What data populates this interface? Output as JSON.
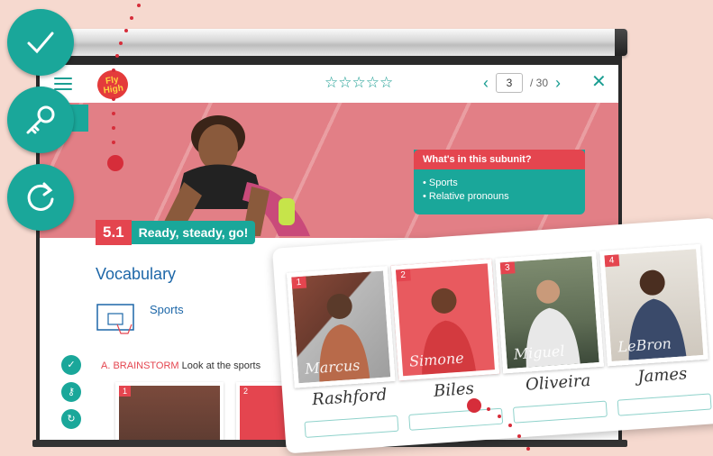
{
  "header": {
    "logo_text": "Fly High",
    "rating_stars": "☆☆☆☆☆",
    "prev_icon": "chevron-left-icon",
    "next_icon": "chevron-right-icon",
    "page_current": "3",
    "page_total": "/ 30",
    "close_icon": "close-icon"
  },
  "hero": {
    "subunit_title": "What's in this subunit?",
    "subunit_items": [
      "Sports",
      "Relative pronouns"
    ],
    "unit_number": "5.1",
    "unit_title": "Ready, steady, go!"
  },
  "content": {
    "section_title": "Vocabulary",
    "topic_label": "Sports",
    "exercise_prefix": "A. BRAINSTORM",
    "exercise_text": "Look at the sports"
  },
  "tools": [
    "check-icon",
    "key-icon",
    "refresh-icon"
  ],
  "cards": [
    {
      "n": "1",
      "signature": "Marcus",
      "handwritten": "Rashford"
    },
    {
      "n": "2",
      "signature": "Simone",
      "handwritten": "Biles"
    },
    {
      "n": "3",
      "signature": "Miguel",
      "handwritten": "Oliveira"
    },
    {
      "n": "4",
      "signature": "LeBron",
      "handwritten": "James"
    }
  ],
  "colors": {
    "teal": "#1aa79a",
    "red": "#e4454f",
    "blue": "#1d67a8"
  }
}
